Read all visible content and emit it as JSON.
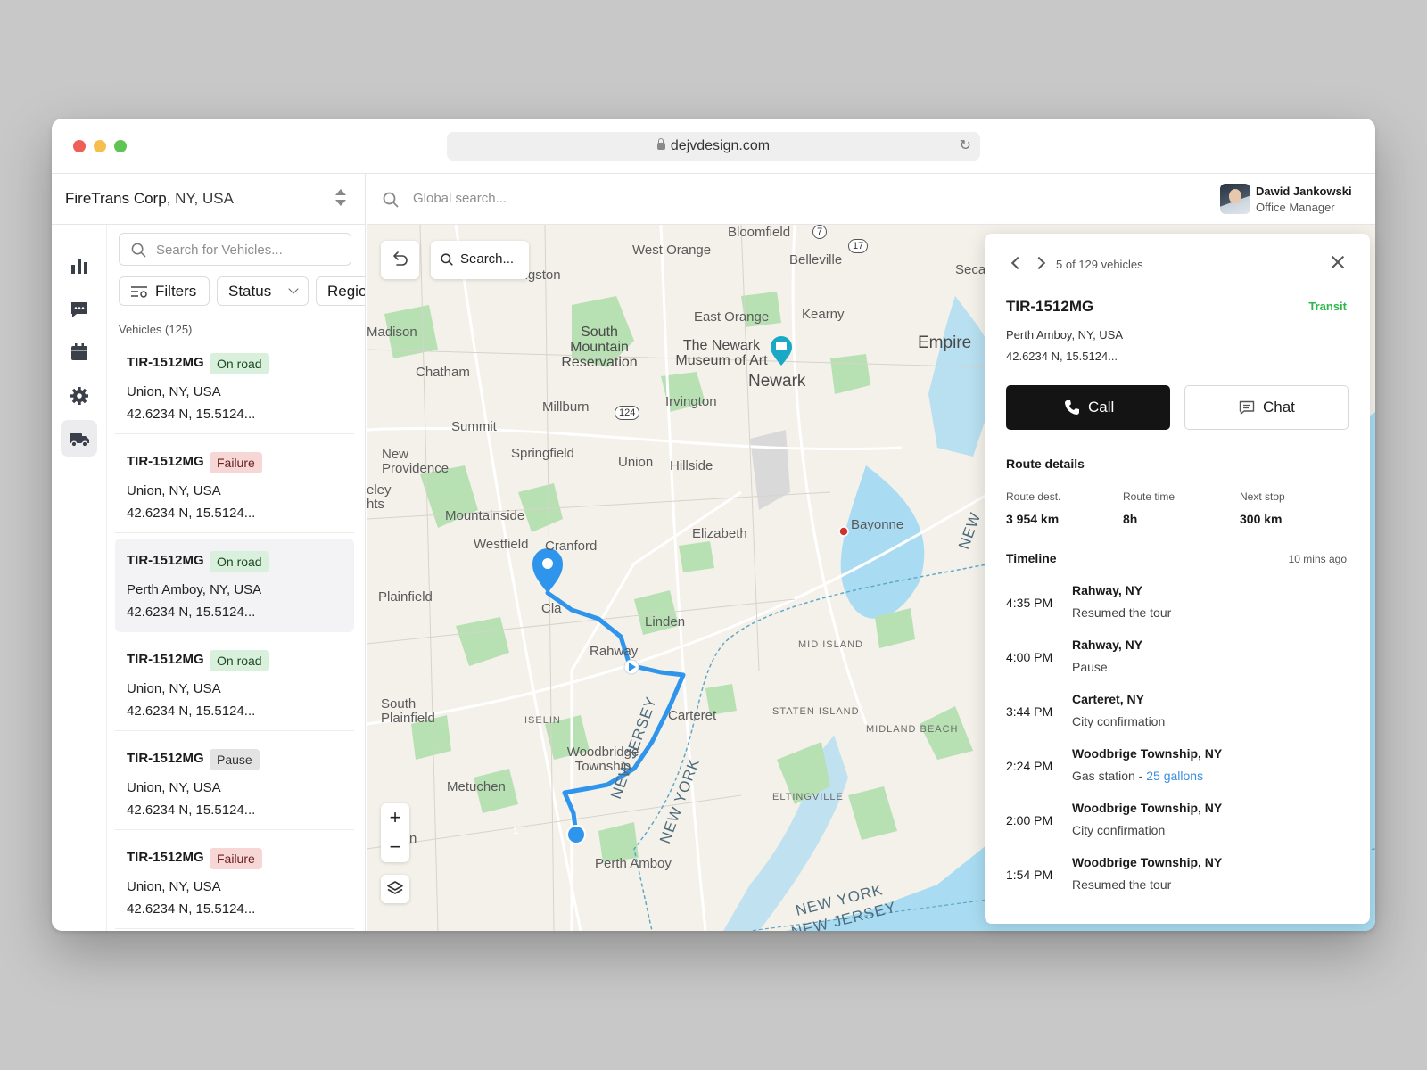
{
  "browser": {
    "url": "dejvdesign.com"
  },
  "org": {
    "name": "FireTrans Corp",
    "location": ", NY, USA"
  },
  "topbar": {
    "search_placeholder": "Global search..."
  },
  "user": {
    "name": "Dawid Jankowski",
    "role": "Office Manager"
  },
  "rail": {
    "items": [
      {
        "icon": "bar-chart-icon"
      },
      {
        "icon": "messages-icon"
      },
      {
        "icon": "calendar-icon"
      },
      {
        "icon": "settings-icon"
      },
      {
        "icon": "truck-icon",
        "active": true
      }
    ]
  },
  "list": {
    "search_placeholder": "Search for Vehicles...",
    "filters_label": "Filters",
    "status_label": "Status",
    "region_label": "Regio",
    "count_label": "Vehicles (125)",
    "vehicles": [
      {
        "id": "TIR-1512MG",
        "status": "On road",
        "location": "Union, NY, USA",
        "coords": "42.6234 N, 15.5124..."
      },
      {
        "id": "TIR-1512MG",
        "status": "Failure",
        "location": "Union, NY, USA",
        "coords": "42.6234 N, 15.5124..."
      },
      {
        "id": "TIR-1512MG",
        "status": "On road",
        "location": "Perth Amboy, NY, USA",
        "coords": "42.6234 N, 15.5124..."
      },
      {
        "id": "TIR-1512MG",
        "status": "On road",
        "location": "Union, NY, USA",
        "coords": "42.6234 N, 15.5124..."
      },
      {
        "id": "TIR-1512MG",
        "status": "Pause",
        "location": "Union, NY, USA",
        "coords": "42.6234 N, 15.5124..."
      },
      {
        "id": "TIR-1512MG",
        "status": "Failure",
        "location": "Union, NY, USA",
        "coords": "42.6234 N, 15.5124..."
      }
    ]
  },
  "map": {
    "search_label": "Search...",
    "route_stop_number": "1",
    "route_color": "#2f95ec",
    "labels": {
      "bloomfield": "Bloomfield",
      "west_orange": "West Orange",
      "belleville": "Belleville",
      "secaucus": "Secau",
      "livingston": "Livingston",
      "east_orange": "East Orange",
      "kearny": "Kearny",
      "south_mountain": "South Mountain Reservation",
      "newark_museum": "The Newark Museum of Art",
      "empire": "Empire",
      "madison": "Madison",
      "chatham": "Chatham",
      "newark": "Newark",
      "millburn": "Millburn",
      "irvington": "Irvington",
      "summit": "Summit",
      "new_providence": "New Providence",
      "springfield": "Springfield",
      "union": "Union",
      "hillside": "Hillside",
      "berkeley": "eley hts",
      "mountainside": "Mountainside",
      "westfield": "Westfield",
      "cranford": "Cranford",
      "elizabeth": "Elizabeth",
      "bayonne": "Bayonne",
      "plainfield": "Plainfield",
      "clark": "Cla",
      "linden": "Linden",
      "rahway": "Rahway",
      "mid_island": "MID ISLAND",
      "south_plainfield": "South Plainfield",
      "iselin": "ISELIN",
      "carteret": "Carteret",
      "staten_island": "STATEN ISLAND",
      "midland_beach": "MIDLAND BEACH",
      "woodbridge": "Woodbridge Township",
      "metuchen": "Metuchen",
      "eltingville": "ELTINGVILLE",
      "perth_amboy": "Perth Amboy",
      "nj_vertical": "NEW JERSEY",
      "ny_vertical": "NEW YORK",
      "ny_bottom": "NEW YORK",
      "nj_bottom": "NEW JERSEY",
      "nj_top": "NEW",
      "edison_cut": "n"
    },
    "shields": {
      "r7": "7",
      "r17": "17",
      "r124": "124"
    }
  },
  "detail": {
    "counter": "5 of 129 vehicles",
    "vehicle_id": "TIR-1512MG",
    "status": "Transit",
    "status_color": "#2eb84c",
    "location": "Perth Amboy, NY, USA",
    "coords": "42.6234 N, 15.5124...",
    "call_label": "Call",
    "chat_label": "Chat",
    "route_title": "Route details",
    "metrics": [
      {
        "label": "Route dest.",
        "value": "3 954 km"
      },
      {
        "label": "Route time",
        "value": "8h"
      },
      {
        "label": "Next stop",
        "value": "300 km"
      }
    ],
    "timeline_title": "Timeline",
    "timeline_ago": "10 mins ago",
    "timeline": [
      {
        "time": "4:35 PM",
        "place": "Rahway, NY",
        "event": "Resumed the tour",
        "link": ""
      },
      {
        "time": "4:00 PM",
        "place": "Rahway, NY",
        "event": "Pause",
        "link": ""
      },
      {
        "time": "3:44 PM",
        "place": "Carteret, NY",
        "event": "City confirmation",
        "link": ""
      },
      {
        "time": "2:24 PM",
        "place": "Woodbrige Township, NY",
        "event": "Gas station - ",
        "link": "25 gallons"
      },
      {
        "time": "2:00 PM",
        "place": "Woodbrige Township, NY",
        "event": "City confirmation",
        "link": ""
      },
      {
        "time": "1:54 PM",
        "place": "Woodbrige Township, NY",
        "event": "Resumed the tour",
        "link": ""
      }
    ]
  }
}
